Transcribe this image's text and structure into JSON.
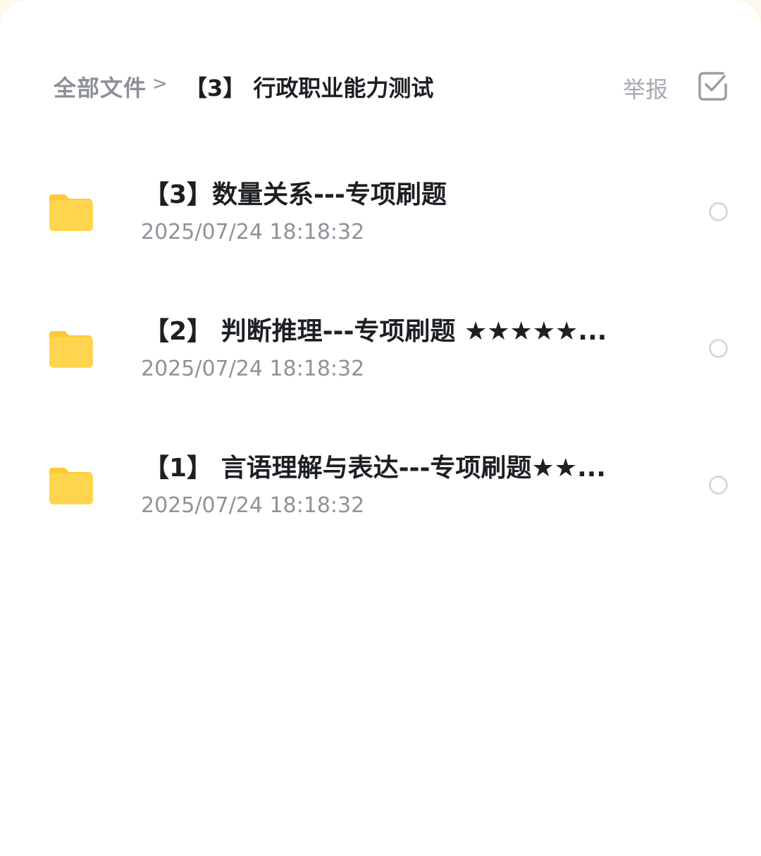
{
  "breadcrumb": {
    "root": "全部文件",
    "separator": ">",
    "current": "【3】 行政职业能力测试"
  },
  "header_actions": {
    "report_label": "举报",
    "select_icon": "checkbox-icon"
  },
  "files": [
    {
      "name": "【3】数量关系---专项刷题",
      "date": "2025/07/24 18:18:32",
      "icon": "folder-icon"
    },
    {
      "name": "【2】 判断推理---专项刷题 ★★★★★...",
      "date": "2025/07/24 18:18:32",
      "icon": "folder-icon"
    },
    {
      "name": "【1】 言语理解与表达---专项刷题★★...",
      "date": "2025/07/24 18:18:32",
      "icon": "folder-icon"
    }
  ],
  "colors": {
    "folder": "#ffd54f",
    "folder_tab": "#ffc933",
    "title": "#1c1f23",
    "muted": "#8f9298",
    "radio_border": "#d7d9dc"
  }
}
